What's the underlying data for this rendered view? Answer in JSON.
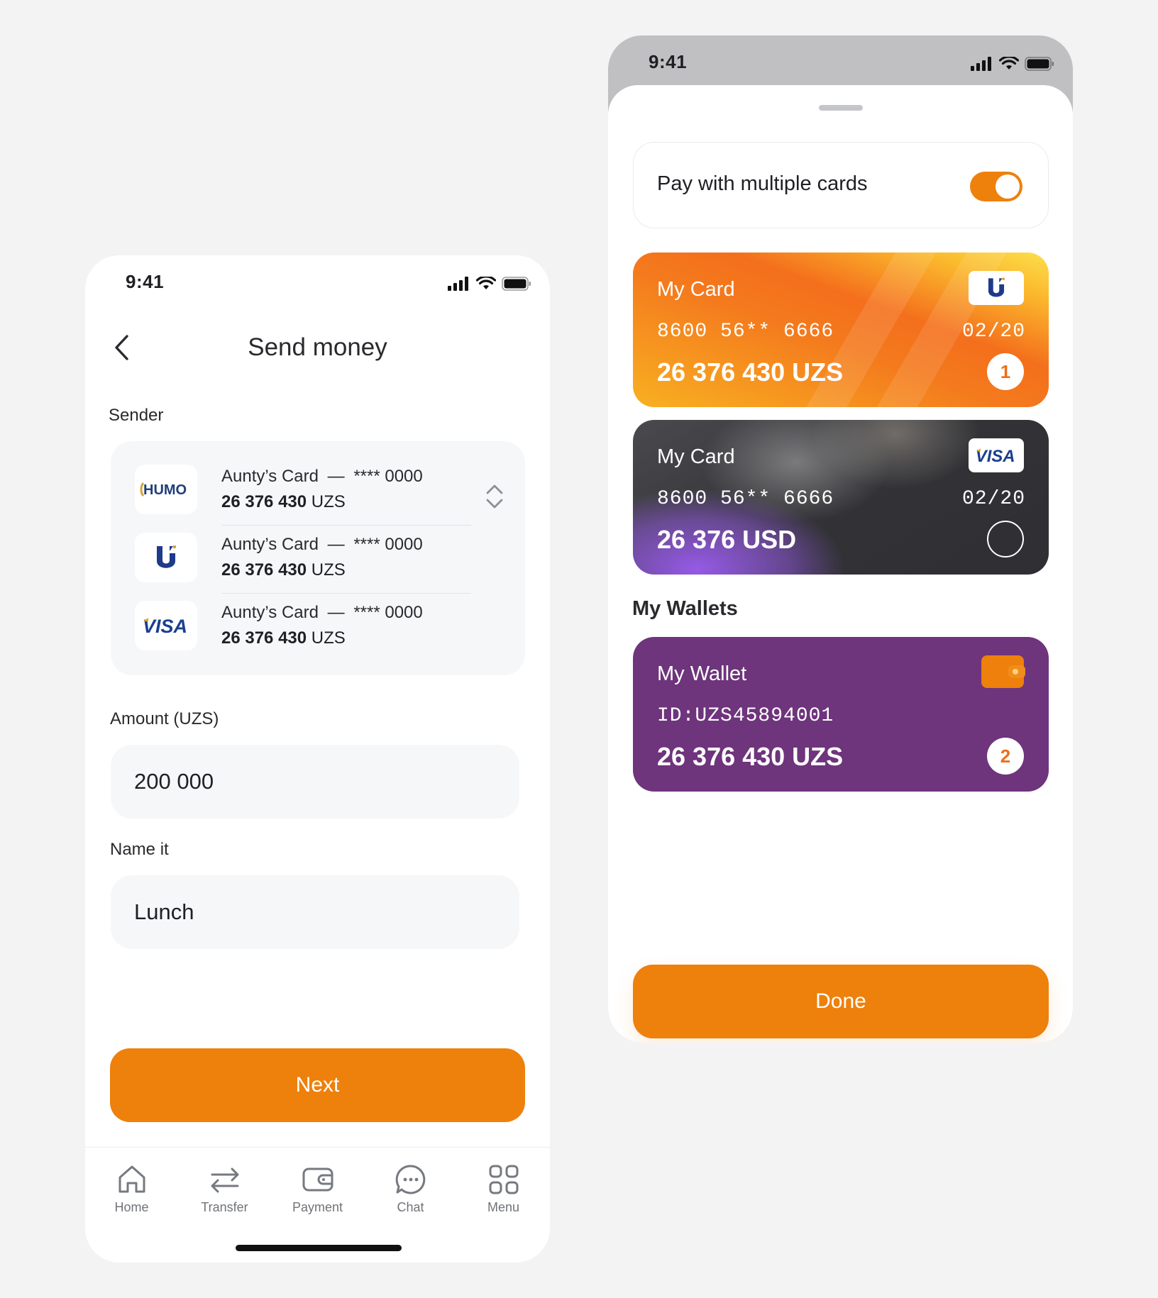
{
  "screen1": {
    "status_time": "9:41",
    "title": "Send money",
    "sender_label": "Sender",
    "cards": [
      {
        "brand": "HUMO",
        "name": "Aunty’s Card",
        "dash": "—",
        "masked": "**** 0000",
        "balance": "26 376 430",
        "currency": "UZS"
      },
      {
        "brand": "U",
        "name": "Aunty’s Card",
        "dash": "—",
        "masked": "**** 0000",
        "balance": "26 376 430",
        "currency": "UZS"
      },
      {
        "brand": "VISA",
        "name": "Aunty’s Card",
        "dash": "—",
        "masked": "**** 0000",
        "balance": "26 376 430",
        "currency": "UZS"
      }
    ],
    "amount_label": "Amount (UZS)",
    "amount_value": "200 000",
    "name_label": "Name it",
    "name_value": "Lunch",
    "next_label": "Next",
    "tabs": [
      {
        "label": "Home",
        "icon": "home-icon"
      },
      {
        "label": "Transfer",
        "icon": "transfer-icon"
      },
      {
        "label": "Payment",
        "icon": "wallet-icon"
      },
      {
        "label": "Chat",
        "icon": "chat-icon"
      },
      {
        "label": "Menu",
        "icon": "grid-icon"
      }
    ]
  },
  "screen2": {
    "status_time": "9:41",
    "multi_card_label": "Pay with multiple cards",
    "multi_card_enabled": true,
    "cards": [
      {
        "title": "My Card",
        "number": "8600 56** 6666",
        "expiry": "02/20",
        "balance": "26 376 430 UZS",
        "brand": "U",
        "selected_order": "1"
      },
      {
        "title": "My Card",
        "number": "8600 56** 6666",
        "expiry": "02/20",
        "balance": "26 376 USD",
        "brand": "VISA",
        "selected_order": ""
      }
    ],
    "wallets_title": "My Wallets",
    "wallet": {
      "title": "My Wallet",
      "id": "ID:UZS45894001",
      "balance": "26 376 430 UZS",
      "selected_order": "2"
    },
    "done_label": "Done"
  },
  "colors": {
    "accent": "#EE800C",
    "wallet_bg": "#6E347C",
    "page_bg": "#F3F3F3"
  }
}
